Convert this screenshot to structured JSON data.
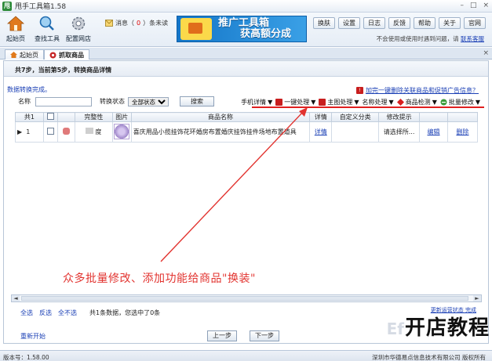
{
  "app": {
    "title": "甩手工具箱1.58",
    "logo_glyph": "甩"
  },
  "window": {
    "minimize": "–",
    "maximize": "□",
    "close": "×"
  },
  "toolbar": {
    "home": "起始页",
    "find_tools": "查找工具",
    "config_shop": "配置网店",
    "message_prefix": "消息（",
    "message_count": "0",
    "message_suffix": "）条未读",
    "banner_line1": "推广工具箱",
    "banner_line2": "获高额分成",
    "links": [
      "换肤",
      "设置",
      "日志",
      "反馈",
      "帮助",
      "关于",
      "官网"
    ],
    "notice_text": "不会使用或使用时遇到问题，请",
    "notice_link": "联系客服"
  },
  "tabs": [
    {
      "label": "起始页",
      "icon": "home-icon"
    },
    {
      "label": "抓取商品",
      "icon": "grab-icon"
    }
  ],
  "tab_close": "×",
  "main": {
    "step_title": "共7步，当前第5步，转换商品详情",
    "status": "数据转换完成。",
    "top_link": "加完一键删除关联商品和促销广告信息？",
    "filter": {
      "name_label": "名称",
      "name_value": "",
      "status_label": "转换状态",
      "status_selected": "全部状态",
      "search_button": "搜索"
    },
    "actions": [
      {
        "label": "手机详情",
        "icon": "",
        "color": ""
      },
      {
        "label": "一键处理",
        "icon": "batch-icon",
        "color": "#c81e1e"
      },
      {
        "label": "主图处理",
        "icon": "image-icon",
        "color": "#c81e1e"
      },
      {
        "label": "名称处理",
        "icon": "",
        "color": ""
      },
      {
        "label": "商品检测",
        "icon": "check-icon",
        "color": "#d82020"
      },
      {
        "label": "批量修改",
        "icon": "edit-icon",
        "color": "#3a9b3a"
      }
    ],
    "action_suffix": "▼",
    "table": {
      "headers": [
        "共1",
        "",
        "",
        "完整性",
        "图片",
        "商品名称",
        "详情",
        "自定义分类",
        "修改提示",
        "",
        ""
      ],
      "row": {
        "marker": "▶",
        "index": "1",
        "completeness": "度",
        "name": "喜庆用品小揽挂饰花环婚房布置婚庆挂饰挂件场地布置道具",
        "detail": "详情",
        "custom_category": "",
        "hint": "请选择所...",
        "edit": "编辑",
        "delete": "删除"
      }
    },
    "annotation": "众多批量修改、添加功能给商品\"换装\"",
    "scroll_left": "◄",
    "scroll_right": "►",
    "select_all": "全选",
    "select_invert": "反选",
    "select_none": "全不选",
    "select_info": "共1条数据，您选中了0条",
    "right_small": "更新运营状态  完成",
    "restart": "重新开始",
    "prev": "上一步",
    "next": "下一步"
  },
  "statusbar": {
    "version": "版本号：1.58.00",
    "copyright": "深圳市华德易点信息技术有限公司 版权所有"
  },
  "watermark": "开店教程",
  "watermark_ghost": "Ef"
}
